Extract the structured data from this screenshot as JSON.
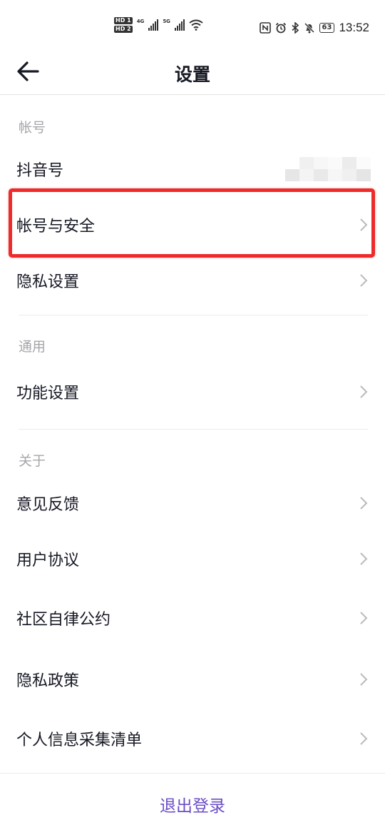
{
  "status_bar": {
    "hd1": "HD 1",
    "hd2": "HD 2",
    "net1": "4G",
    "net2": "5G",
    "battery": "63",
    "time": "13:52",
    "icons": [
      "nfc-icon",
      "alarm-icon",
      "bluetooth-icon",
      "mute-icon"
    ]
  },
  "nav": {
    "title": "设置",
    "back_icon": "back-arrow-icon"
  },
  "sections": {
    "account": {
      "header": "帐号",
      "items": [
        "抖音号",
        "帐号与安全",
        "隐私设置"
      ]
    },
    "general": {
      "header": "通用",
      "items": [
        "功能设置"
      ]
    },
    "about": {
      "header": "关于",
      "items": [
        "意见反馈",
        "用户协议",
        "社区自律公约",
        "隐私政策",
        "个人信息采集清单"
      ]
    }
  },
  "logout_label": "退出登录",
  "colors": {
    "highlight": "#ee2a2a",
    "logout": "#6b4ec6",
    "section_header": "#a6a6ab"
  }
}
